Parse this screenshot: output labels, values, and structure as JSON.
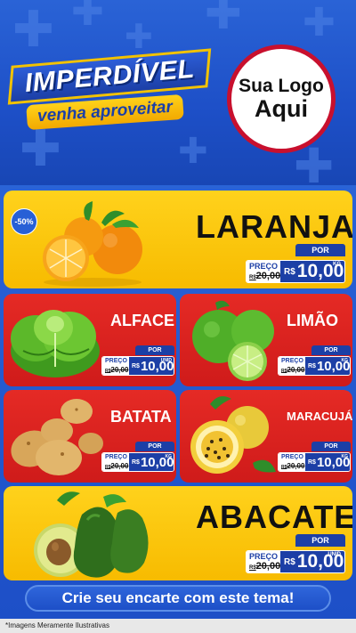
{
  "header": {
    "title": "IMPERDÍVEL",
    "subtitle": "venha aproveitar",
    "logo_line1": "Sua Logo",
    "logo_line2": "Aqui"
  },
  "products": [
    {
      "name": "LARANJA",
      "discount": "-50%",
      "por": "POR",
      "preco_label": "PREÇO",
      "old_prefix": "R$",
      "old_price": "20,00",
      "currency": "R$",
      "price": "10,00",
      "unit": "KG"
    },
    {
      "name": "ALFACE",
      "por": "POR",
      "preco_label": "PREÇO",
      "old_prefix": "R$",
      "old_price": "20,00",
      "currency": "R$",
      "price": "10,00",
      "unit": "UNID"
    },
    {
      "name": "LIMÃO",
      "por": "POR",
      "preco_label": "PREÇO",
      "old_prefix": "R$",
      "old_price": "20,00",
      "currency": "R$",
      "price": "10,00",
      "unit": "KG"
    },
    {
      "name": "BATATA",
      "por": "POR",
      "preco_label": "PREÇO",
      "old_prefix": "R$",
      "old_price": "20,00",
      "currency": "R$",
      "price": "10,00",
      "unit": "KG"
    },
    {
      "name": "MARACUJÁ",
      "por": "POR",
      "preco_label": "PREÇO",
      "old_prefix": "R$",
      "old_price": "20,00",
      "currency": "R$",
      "price": "10,00",
      "unit": "KG"
    },
    {
      "name": "ABACATE",
      "por": "POR",
      "preco_label": "PREÇO",
      "old_prefix": "R$",
      "old_price": "20,00",
      "currency": "R$",
      "price": "10,00",
      "unit": "UNID"
    }
  ],
  "footer": {
    "cta": "Crie seu encarte com este tema!",
    "disclaimer": "*Imagens Meramente Ilustrativas"
  },
  "colors": {
    "brand_blue": "#1d4fc7",
    "yellow": "#ffd21c",
    "red": "#e52a25"
  },
  "icons": [
    "plus-decoration-icon"
  ]
}
